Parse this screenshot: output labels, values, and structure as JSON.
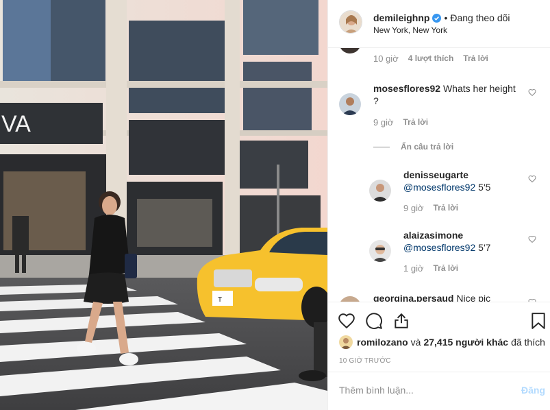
{
  "header": {
    "username": "demileighnp",
    "separator": "•",
    "follow_state": "Đang theo dõi",
    "location": "New York, New York"
  },
  "photo": {
    "storefront_sign": "VA",
    "taxi_plate": "T",
    "colors": {
      "taxi": "#f6c12d",
      "building": "#e8e2da",
      "street": "#4b4b4d"
    }
  },
  "comments": {
    "top_meta": {
      "time": "10 giờ",
      "likes": "4 lượt thích",
      "reply": "Trả lời"
    },
    "c1": {
      "user": "mosesflores92",
      "text": "Whats her height ?",
      "time": "9 giờ",
      "reply": "Trả lời"
    },
    "hide_replies": "Ẩn câu trả lời",
    "r1": {
      "user": "denisseugarte",
      "mention": "@mosesflores92",
      "text": "5'5",
      "time": "9 giờ",
      "reply": "Trả lời"
    },
    "r2": {
      "user": "alaizasimone",
      "mention": "@mosesflores92",
      "text": "5'7",
      "time": "1 giờ",
      "reply": "Trả lời"
    },
    "c2": {
      "user": "georgina.persaud",
      "text": "Nice pic"
    }
  },
  "likes": {
    "user": "romilozano",
    "connector": "và",
    "count_text": "27,415 người khác",
    "suffix": "đã thích"
  },
  "timestamp": "10 GIỜ TRƯỚC",
  "comment_input": {
    "placeholder": "Thêm bình luận...",
    "post_label": "Đăng"
  },
  "icons": [
    "heart-icon",
    "comment-icon",
    "share-icon",
    "bookmark-icon",
    "verified-icon"
  ],
  "colors": {
    "accent": "#3897f0",
    "mention": "#00376b",
    "muted": "#8e8e8e",
    "post_disabled": "#b3dbff"
  }
}
